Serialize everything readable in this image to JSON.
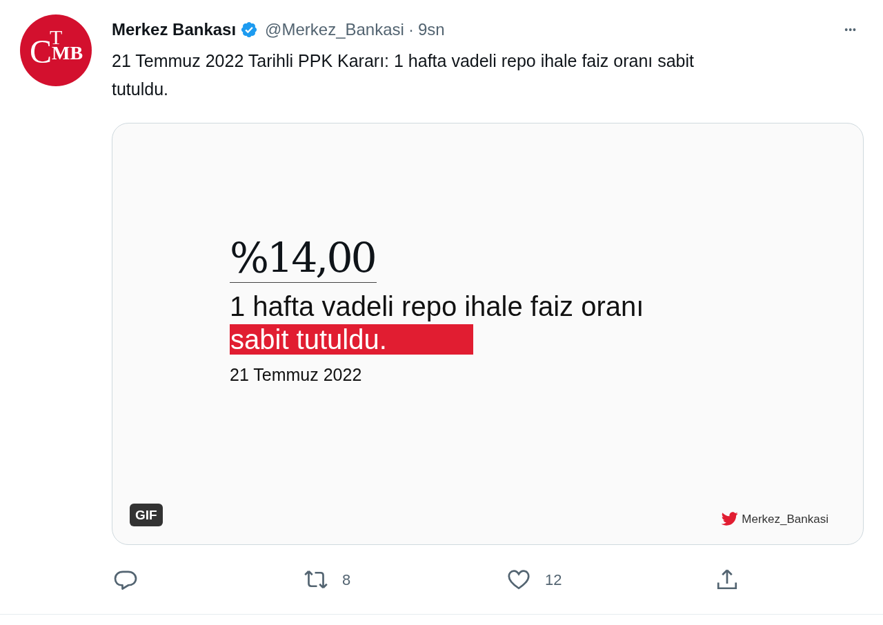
{
  "avatar": {
    "top": "T",
    "left": "C",
    "main": "MB"
  },
  "author": {
    "name": "Merkez Bankası",
    "verified": true,
    "handle": "@Merkez_Bankasi",
    "separator": "·",
    "time": "9sn"
  },
  "more": "•••",
  "text": "21 Temmuz 2022 Tarihli PPK Kararı: 1 hafta vadeli repo ihale faiz oranı sabit tutuldu.",
  "media": {
    "rate": "%14,00",
    "headline": "1 hafta vadeli repo ihale faiz oranı",
    "highlight": "sabit tutuldu.",
    "date": "21 Temmuz 2022",
    "badge": "GIF",
    "credit": "Merkez_Bankasi"
  },
  "actions": [
    {
      "kind": "reply"
    },
    {
      "kind": "retweet",
      "count": "8"
    },
    {
      "kind": "like",
      "count": "12"
    },
    {
      "kind": "share"
    }
  ]
}
